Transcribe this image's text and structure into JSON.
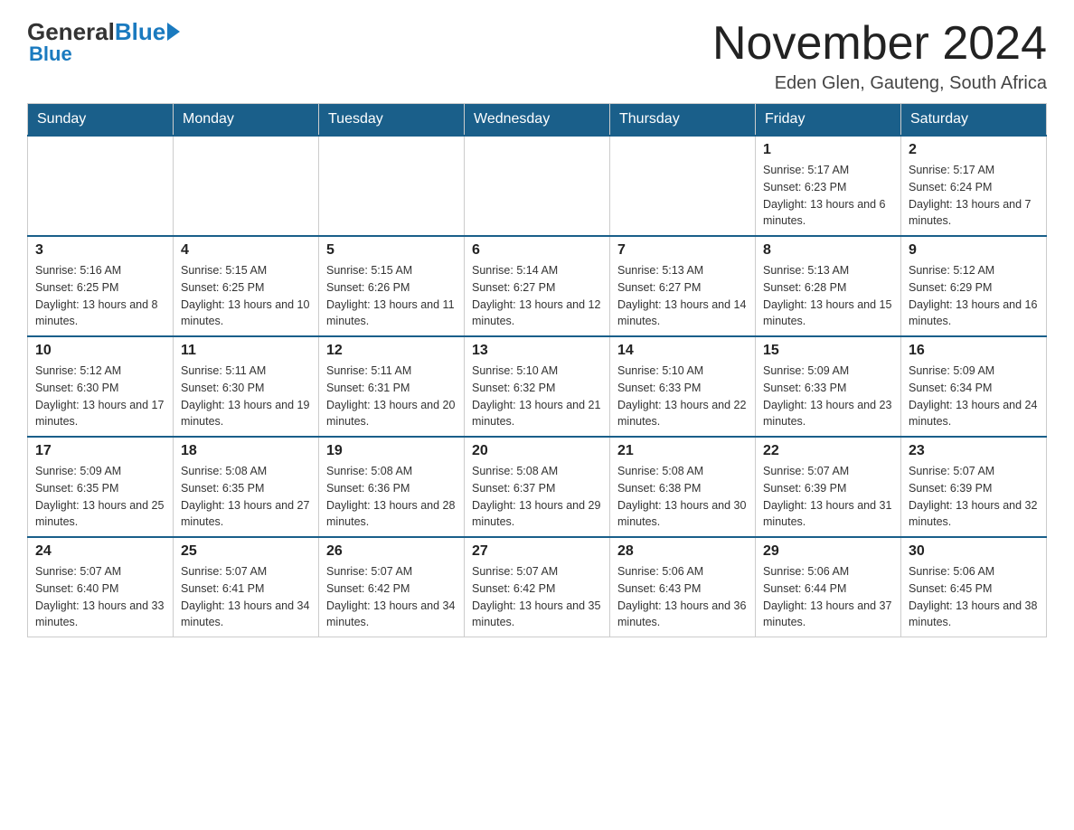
{
  "header": {
    "logo_general": "General",
    "logo_blue": "Blue",
    "title": "November 2024",
    "subtitle": "Eden Glen, Gauteng, South Africa"
  },
  "days_of_week": [
    "Sunday",
    "Monday",
    "Tuesday",
    "Wednesday",
    "Thursday",
    "Friday",
    "Saturday"
  ],
  "weeks": [
    [
      {
        "day": "",
        "info": ""
      },
      {
        "day": "",
        "info": ""
      },
      {
        "day": "",
        "info": ""
      },
      {
        "day": "",
        "info": ""
      },
      {
        "day": "",
        "info": ""
      },
      {
        "day": "1",
        "info": "Sunrise: 5:17 AM\nSunset: 6:23 PM\nDaylight: 13 hours and 6 minutes."
      },
      {
        "day": "2",
        "info": "Sunrise: 5:17 AM\nSunset: 6:24 PM\nDaylight: 13 hours and 7 minutes."
      }
    ],
    [
      {
        "day": "3",
        "info": "Sunrise: 5:16 AM\nSunset: 6:25 PM\nDaylight: 13 hours and 8 minutes."
      },
      {
        "day": "4",
        "info": "Sunrise: 5:15 AM\nSunset: 6:25 PM\nDaylight: 13 hours and 10 minutes."
      },
      {
        "day": "5",
        "info": "Sunrise: 5:15 AM\nSunset: 6:26 PM\nDaylight: 13 hours and 11 minutes."
      },
      {
        "day": "6",
        "info": "Sunrise: 5:14 AM\nSunset: 6:27 PM\nDaylight: 13 hours and 12 minutes."
      },
      {
        "day": "7",
        "info": "Sunrise: 5:13 AM\nSunset: 6:27 PM\nDaylight: 13 hours and 14 minutes."
      },
      {
        "day": "8",
        "info": "Sunrise: 5:13 AM\nSunset: 6:28 PM\nDaylight: 13 hours and 15 minutes."
      },
      {
        "day": "9",
        "info": "Sunrise: 5:12 AM\nSunset: 6:29 PM\nDaylight: 13 hours and 16 minutes."
      }
    ],
    [
      {
        "day": "10",
        "info": "Sunrise: 5:12 AM\nSunset: 6:30 PM\nDaylight: 13 hours and 17 minutes."
      },
      {
        "day": "11",
        "info": "Sunrise: 5:11 AM\nSunset: 6:30 PM\nDaylight: 13 hours and 19 minutes."
      },
      {
        "day": "12",
        "info": "Sunrise: 5:11 AM\nSunset: 6:31 PM\nDaylight: 13 hours and 20 minutes."
      },
      {
        "day": "13",
        "info": "Sunrise: 5:10 AM\nSunset: 6:32 PM\nDaylight: 13 hours and 21 minutes."
      },
      {
        "day": "14",
        "info": "Sunrise: 5:10 AM\nSunset: 6:33 PM\nDaylight: 13 hours and 22 minutes."
      },
      {
        "day": "15",
        "info": "Sunrise: 5:09 AM\nSunset: 6:33 PM\nDaylight: 13 hours and 23 minutes."
      },
      {
        "day": "16",
        "info": "Sunrise: 5:09 AM\nSunset: 6:34 PM\nDaylight: 13 hours and 24 minutes."
      }
    ],
    [
      {
        "day": "17",
        "info": "Sunrise: 5:09 AM\nSunset: 6:35 PM\nDaylight: 13 hours and 25 minutes."
      },
      {
        "day": "18",
        "info": "Sunrise: 5:08 AM\nSunset: 6:35 PM\nDaylight: 13 hours and 27 minutes."
      },
      {
        "day": "19",
        "info": "Sunrise: 5:08 AM\nSunset: 6:36 PM\nDaylight: 13 hours and 28 minutes."
      },
      {
        "day": "20",
        "info": "Sunrise: 5:08 AM\nSunset: 6:37 PM\nDaylight: 13 hours and 29 minutes."
      },
      {
        "day": "21",
        "info": "Sunrise: 5:08 AM\nSunset: 6:38 PM\nDaylight: 13 hours and 30 minutes."
      },
      {
        "day": "22",
        "info": "Sunrise: 5:07 AM\nSunset: 6:39 PM\nDaylight: 13 hours and 31 minutes."
      },
      {
        "day": "23",
        "info": "Sunrise: 5:07 AM\nSunset: 6:39 PM\nDaylight: 13 hours and 32 minutes."
      }
    ],
    [
      {
        "day": "24",
        "info": "Sunrise: 5:07 AM\nSunset: 6:40 PM\nDaylight: 13 hours and 33 minutes."
      },
      {
        "day": "25",
        "info": "Sunrise: 5:07 AM\nSunset: 6:41 PM\nDaylight: 13 hours and 34 minutes."
      },
      {
        "day": "26",
        "info": "Sunrise: 5:07 AM\nSunset: 6:42 PM\nDaylight: 13 hours and 34 minutes."
      },
      {
        "day": "27",
        "info": "Sunrise: 5:07 AM\nSunset: 6:42 PM\nDaylight: 13 hours and 35 minutes."
      },
      {
        "day": "28",
        "info": "Sunrise: 5:06 AM\nSunset: 6:43 PM\nDaylight: 13 hours and 36 minutes."
      },
      {
        "day": "29",
        "info": "Sunrise: 5:06 AM\nSunset: 6:44 PM\nDaylight: 13 hours and 37 minutes."
      },
      {
        "day": "30",
        "info": "Sunrise: 5:06 AM\nSunset: 6:45 PM\nDaylight: 13 hours and 38 minutes."
      }
    ]
  ]
}
